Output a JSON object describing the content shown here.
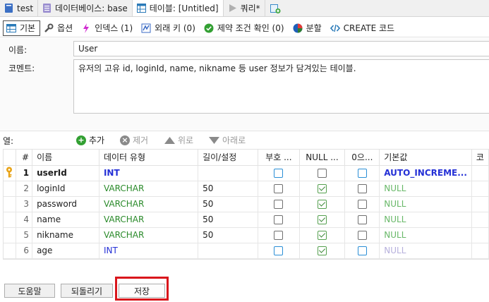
{
  "tabs": [
    {
      "label": "test",
      "icon": "database-icon"
    },
    {
      "label": "데이터베이스: base",
      "icon": "database-list-icon"
    },
    {
      "label": "테이블: [Untitled]",
      "icon": "table-icon"
    },
    {
      "label": "쿼리*",
      "icon": "play-icon"
    }
  ],
  "subtabs": [
    {
      "label": "기본",
      "icon": "table-grid-icon"
    },
    {
      "label": "옵션",
      "icon": "wrench-icon"
    },
    {
      "label": "인덱스 (1)",
      "icon": "lightning-icon"
    },
    {
      "label": "외래 키 (0)",
      "icon": "foreign-key-icon"
    },
    {
      "label": "제약 조건 확인 (0)",
      "icon": "check-circle-icon"
    },
    {
      "label": "분할",
      "icon": "pie-icon"
    },
    {
      "label": "CREATE 코드",
      "icon": "code-icon"
    }
  ],
  "form": {
    "name_label": "이름:",
    "name_value": "User",
    "comment_label": "코멘트:",
    "comment_value": "유저의 고유 id, loginId, name, nikname 등 user 정보가 담겨있는 테이블."
  },
  "columns_toolbar": {
    "label": "열:",
    "add": "추가",
    "remove": "제거",
    "up": "위로",
    "down": "아래로"
  },
  "grid": {
    "headers": [
      "#",
      "이름",
      "데이터 유형",
      "길이/설정",
      "부호 ...",
      "NULL ...",
      "0으...",
      "기본값",
      "코"
    ],
    "rows": [
      {
        "num": "1",
        "name": "userId",
        "type": "INT",
        "length": "",
        "unsigned": false,
        "nullable": false,
        "zerofill": false,
        "default": "AUTO_INCREME...",
        "key": true
      },
      {
        "num": "2",
        "name": "loginId",
        "type": "VARCHAR",
        "length": "50",
        "unsigned": false,
        "nullable": true,
        "zerofill": false,
        "default": "NULL",
        "key": false
      },
      {
        "num": "3",
        "name": "password",
        "type": "VARCHAR",
        "length": "50",
        "unsigned": false,
        "nullable": true,
        "zerofill": false,
        "default": "NULL",
        "key": false
      },
      {
        "num": "4",
        "name": "name",
        "type": "VARCHAR",
        "length": "50",
        "unsigned": false,
        "nullable": true,
        "zerofill": false,
        "default": "NULL",
        "key": false
      },
      {
        "num": "5",
        "name": "nikname",
        "type": "VARCHAR",
        "length": "50",
        "unsigned": false,
        "nullable": true,
        "zerofill": false,
        "default": "NULL",
        "key": false
      },
      {
        "num": "6",
        "name": "age",
        "type": "INT",
        "length": "",
        "unsigned": false,
        "nullable": true,
        "zerofill": false,
        "default": "NULL",
        "key": false
      }
    ]
  },
  "bottom": {
    "help": "도움말",
    "revert": "되돌리기",
    "save": "저장"
  },
  "colors": {
    "highlight": "#d9161c",
    "int_type": "#2430d6",
    "varchar_type": "#2a8a2a"
  }
}
